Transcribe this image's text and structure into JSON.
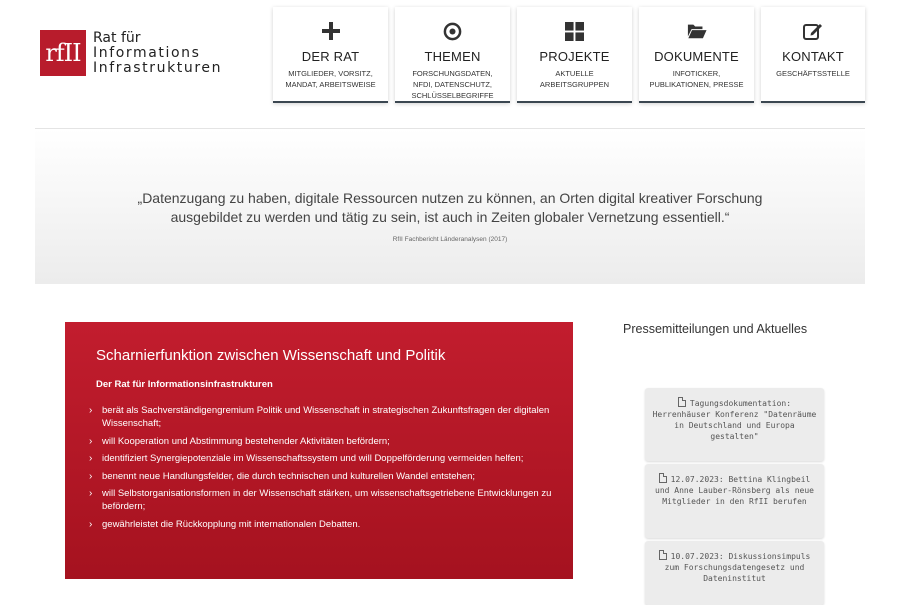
{
  "logo": {
    "mark": "rfII",
    "line1": "Rat für",
    "line2": "Informations",
    "line3": "Infrastrukturen"
  },
  "nav": [
    {
      "title": "DER RAT",
      "icon": "plus-icon",
      "sub": [
        "MITGLIEDER, VORSITZ,",
        "MANDAT, ARBEITSWEISE"
      ]
    },
    {
      "title": "THEMEN",
      "icon": "target-icon",
      "sub": [
        "FORSCHUNGSDATEN,",
        "NFDI, DATENSCHUTZ,",
        "SCHLÜSSELBEGRIFFE"
      ]
    },
    {
      "title": "PROJEKTE",
      "icon": "grid-icon",
      "sub": [
        "AKTUELLE",
        "ARBEITSGRUPPEN"
      ]
    },
    {
      "title": "DOKUMENTE",
      "icon": "folder-open-icon",
      "sub": [
        "INFOTICKER,",
        "PUBLIKATIONEN, PRESSE"
      ]
    },
    {
      "title": "KONTAKT",
      "icon": "edit-icon",
      "sub": [
        "GESCHÄFTSSTELLE"
      ]
    }
  ],
  "quote": {
    "text": "„Datenzugang zu haben, digitale Ressourcen nutzen zu können, an Orten digital kreativer Forschung ausgebildet zu werden und tätig zu sein, ist auch in Zeiten globaler Vernetzung essentiell.“",
    "source": "RfII Fachbericht Länderanalysen (2017)"
  },
  "about": {
    "title": "Scharnierfunktion zwischen Wissenschaft und Politik",
    "subtitle": "Der Rat für Informationsinfrastrukturen",
    "items": [
      "berät als Sachverständigengremium Politik und Wissenschaft in strategischen Zukunftsfragen der digitalen Wissenschaft;",
      "will Kooperation und Abstimmung bestehender Aktivitäten befördern;",
      "identifiziert Synergiepotenziale im Wissenschaftssystem und will Doppelförderung vermeiden helfen;",
      "benennt neue Handlungsfelder, die durch technischen und kulturellen Wandel entstehen;",
      "will Selbstorganisationsformen in der Wissenschaft stärken, um wissenschaftsgetriebene Entwicklungen zu befördern;",
      "gewährleistet die Rückkopplung mit internationalen Debatten."
    ]
  },
  "news": {
    "heading": "Pressemitteilungen und Aktuelles",
    "items": [
      "Tagungsdokumentation: Herrenhäuser Konferenz \"Datenräume in Deutschland und Europa gestalten\"",
      "12.07.2023: Bettina Klingbeil und Anne Lauber-Rönsberg als neue Mitglieder in den RfII berufen",
      "10.07.2023: Diskussionsimpuls zum Forschungsdatengesetz und Dateninstitut"
    ]
  },
  "colors": {
    "brand_red": "#b81c2c",
    "nav_border": "#3b4751",
    "card_bg": "#ececec"
  }
}
